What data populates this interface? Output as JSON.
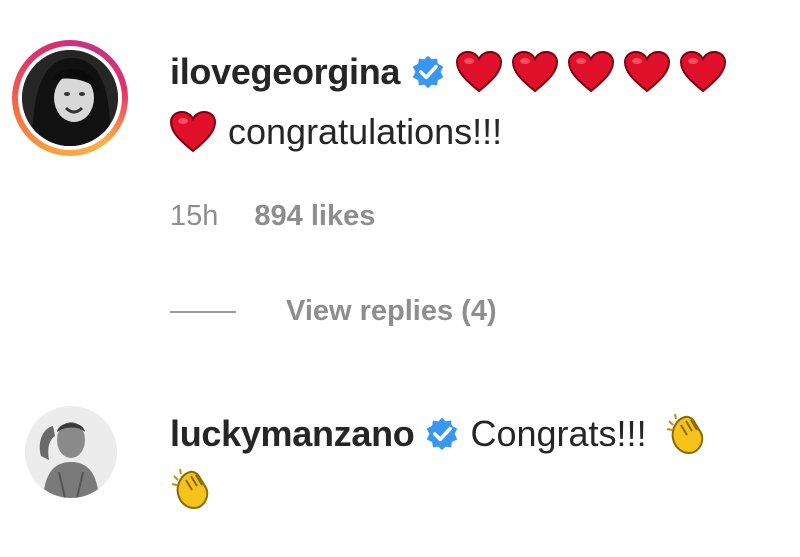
{
  "comments": [
    {
      "username": "ilovegeorgina",
      "text": "congratulations!!!",
      "time": "15h",
      "likes": "894 likes",
      "verified": true,
      "avatar_ring": true,
      "leading_emoji": [
        "red-heart",
        "red-heart",
        "red-heart",
        "red-heart",
        "red-heart",
        "red-heart"
      ]
    },
    {
      "username": "luckymanzano",
      "text": "Congrats!!!",
      "verified": true,
      "avatar_ring": false,
      "trailing_emoji": [
        "clapping-hands",
        "clapping-hands"
      ]
    }
  ],
  "replies": {
    "label": "View replies (4)"
  },
  "colors": {
    "verified_blue": "#3897f0",
    "heart_red": "#e0102a",
    "meta_gray": "#8e8e8e",
    "clap_yellow": "#f6c31c"
  }
}
